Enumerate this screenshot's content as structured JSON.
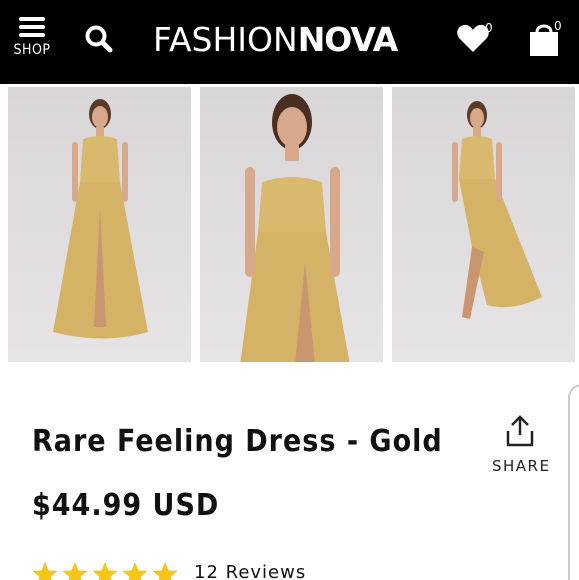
{
  "header": {
    "background": "#000000",
    "shop_label": "SHOP",
    "logo_thin": "FASHION",
    "logo_bold": "NOVA",
    "wishlist_count": "0",
    "cart_count": "0",
    "icons": [
      "menu-icon",
      "search-icon",
      "heart-icon",
      "shopping-bag-icon"
    ]
  },
  "gallery": {
    "images": [
      {
        "alt": "model wearing gold satin dress, full length, angled"
      },
      {
        "alt": "model wearing gold satin dress, front view"
      },
      {
        "alt": "model wearing gold satin dress, walking pose"
      }
    ],
    "dress_color": "#d9b96e"
  },
  "product": {
    "title": "Rare Feeling Dress - Gold",
    "price": "$44.99 USD",
    "share_label": "SHARE",
    "rating": 5,
    "rating_max": 5,
    "star_color": "#f5c518",
    "reviews_label": "12 Reviews"
  }
}
